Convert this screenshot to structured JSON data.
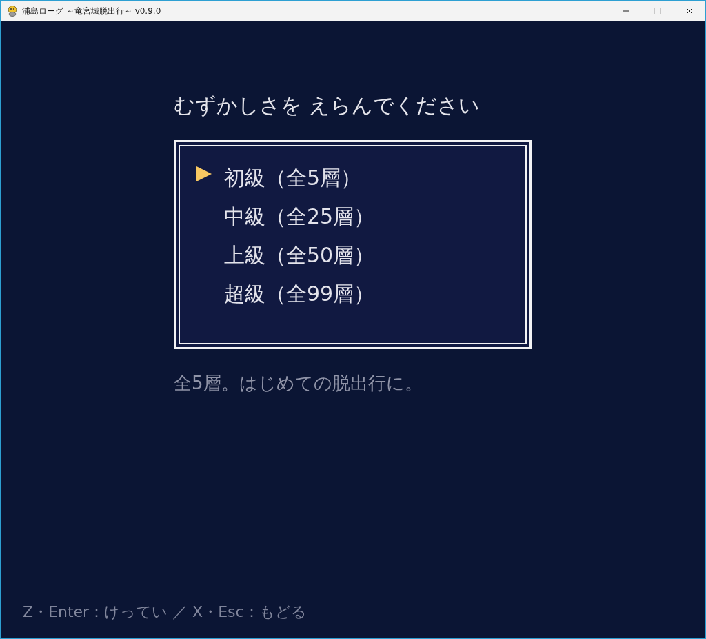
{
  "window": {
    "title": "浦島ローグ ～竜宮城脱出行～ v0.9.0",
    "maximize_disabled": true
  },
  "heading": "むずかしさを えらんでください",
  "difficulty_menu": {
    "items": [
      {
        "label": "初級（全5層）",
        "selected": true
      },
      {
        "label": "中級（全25層）",
        "selected": false
      },
      {
        "label": "上級（全50層）",
        "selected": false
      },
      {
        "label": "超級（全99層）",
        "selected": false
      }
    ]
  },
  "description": "全5層。はじめての脱出行に。",
  "controls_hint": "Z・Enter：けってい ／ X・Esc：もどる"
}
